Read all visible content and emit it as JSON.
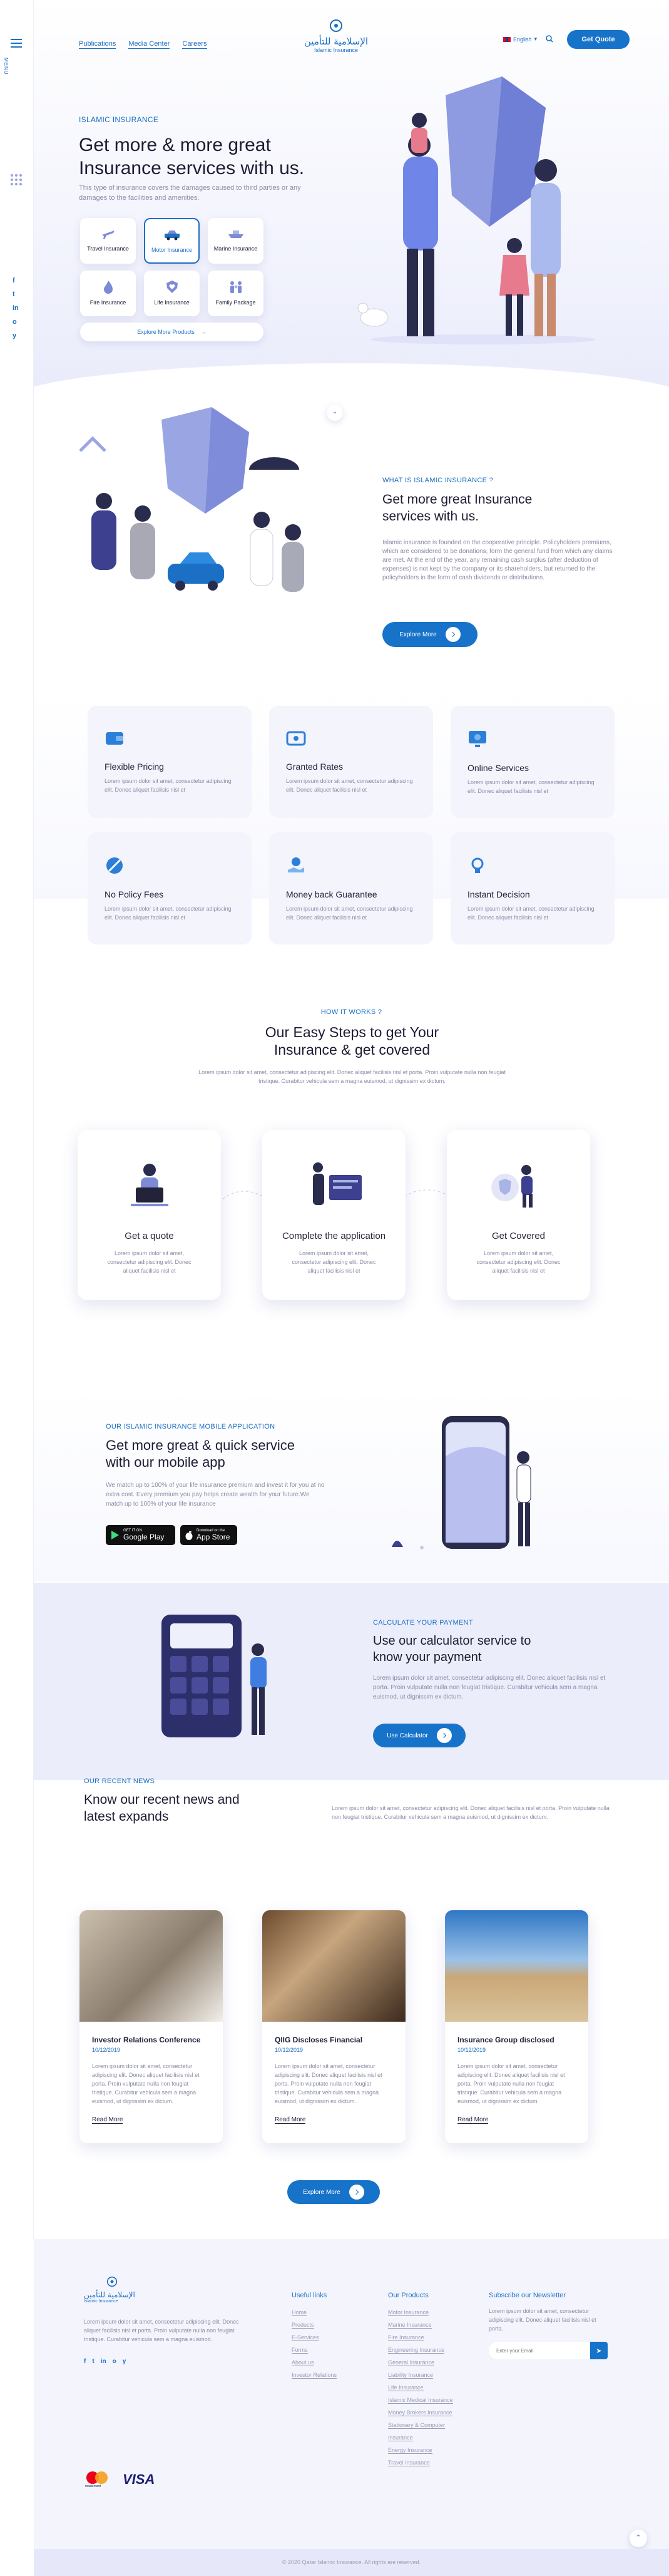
{
  "rail": {
    "menu_label": "MENU",
    "social": [
      "f",
      "t",
      "in",
      "o",
      "y"
    ]
  },
  "nav": {
    "links": [
      "Publications",
      "Media Center",
      "Careers"
    ],
    "logo_ar": "الإسلامية للتأمين",
    "logo_en": "Islamic Insurance",
    "lang": "English",
    "cta": "Get Quote"
  },
  "hero": {
    "eyebrow": "ISLAMIC INSURANCE",
    "title": "Get more & more great Insurance services with us.",
    "desc": "This type of insurance covers the damages caused to third parties or any damages to the facilities and amenities.",
    "categories": [
      "Travel Insurance",
      "Motor Insurance",
      "Marine Insurance",
      "Fire Insurance",
      "Life Insurance",
      "Family Package"
    ],
    "explore": "Explore More Products"
  },
  "about": {
    "eyebrow": "WHAT IS ISLAMIC INSURANCE ?",
    "title": "Get more great Insurance services with us.",
    "desc": "Islamic insurance is founded on the cooperative principle. Policyholders premiums, which are considered to be donations, form the general fund from which any claims are met. At the end of the year, any remaining cash surplus (after deduction of expenses) is not kept by the company or its shareholders, but returned to the policyholders in the form of cash dividends or distributions.",
    "button": "Explore More"
  },
  "features": {
    "items": [
      {
        "title": "Flexible Pricing",
        "text": "Lorem ipsum dolor sit amet, consectetur adipiscing elit. Donec aliquet facilisis nisl et"
      },
      {
        "title": "Granted Rates",
        "text": "Lorem ipsum dolor sit amet, consectetur adipiscing elit. Donec aliquet facilisis nisl et"
      },
      {
        "title": "Online Services",
        "text": "Lorem ipsum dolor sit amet, consectetur adipiscing elit. Donec aliquet facilisis nisl et"
      },
      {
        "title": "No Policy Fees",
        "text": "Lorem ipsum dolor sit amet, consectetur adipiscing elit. Donec aliquet facilisis nisl et"
      },
      {
        "title": "Money back Guarantee",
        "text": "Lorem ipsum dolor sit amet, consectetur adipiscing elit. Donec aliquet facilisis nisl et"
      },
      {
        "title": "Instant Decision",
        "text": "Lorem ipsum dolor sit amet, consectetur adipiscing elit. Donec aliquet facilisis nisl et"
      }
    ]
  },
  "how": {
    "eyebrow": "HOW IT WORKS ?",
    "title": "Our Easy Steps to get Your Insurance & get covered",
    "desc": "Lorem ipsum dolor sit amet, consectetur adipiscing elit. Donec aliquet facilisis nisl et porta. Proin vulputate nulla non feugiat tristique. Curabitur vehicula sem a magna euismod, ut dignissim ex dictum.",
    "steps": [
      {
        "title": "Get a quote",
        "text": "Lorem ipsum dolor sit amet, consectetur adipiscing elit. Donec aliquet facilisis nisl et"
      },
      {
        "title": "Complete the application",
        "text": "Lorem ipsum dolor sit amet, consectetur adipiscing elit. Donec aliquet facilisis nisl et"
      },
      {
        "title": "Get Covered",
        "text": "Lorem ipsum dolor sit amet, consectetur adipiscing elit. Donec aliquet facilisis nisl et"
      }
    ]
  },
  "app": {
    "eyebrow": "OUR ISLAMIC INSURANCE MOBILE APPLICATION",
    "title": "Get more great & quick service with our mobile app",
    "desc": "We match up to 100% of your life insurance premium and invest it for you at no extra cost. Every premium you pay helps create wealth for your future.We match up to 100% of your life insurance",
    "gp_small": "GET IT ON",
    "gp": "Google Play",
    "as_small": "Download on the",
    "as": "App Store"
  },
  "calc": {
    "eyebrow": "CALCULATE YOUR PAYMENT",
    "title": "Use our calculator service to know your payment",
    "desc": "Lorem ipsum dolor sit amet, consectetur adipiscing elit. Donec aliquet facilisis nisl et porta. Proin vulputate nulla non feugiat tristique. Curabitur vehicula sem a magna euismod, ut dignissim ex dictum.",
    "button": "Use Calculator"
  },
  "news": {
    "eyebrow": "OUR RECENT NEWS",
    "title": "Know our recent news and latest expands",
    "desc": "Lorem ipsum dolor sit amet, consectetur adipiscing elit. Donec aliquet facilisis nisl et porta. Proin vulputate nulla non feugiat tristique. Curabitur vehicula sem a magna euismod, ut dignissim ex dictum.",
    "items": [
      {
        "title": "Investor Relations Conference",
        "date": "10/12/2019",
        "text": "Lorem ipsum dolor sit amet, consectetur adipiscing elit. Donec aliquet facilisis nisl et porta. Proin vulputate nulla non feugiat tristique. Curabitur vehicula sem a magna euismod, ut dignissim ex dictum.",
        "more": "Read More"
      },
      {
        "title": "QIIG Discloses Financial",
        "date": "10/12/2019",
        "text": "Lorem ipsum dolor sit amet, consectetur adipiscing elit. Donec aliquet facilisis nisl et porta. Proin vulputate nulla non feugiat tristique. Curabitur vehicula sem a magna euismod, ut dignissim ex dictum.",
        "more": "Read More"
      },
      {
        "title": "Insurance Group disclosed",
        "date": "10/12/2019",
        "text": "Lorem ipsum dolor sit amet, consectetur adipiscing elit. Donec aliquet facilisis nisl et porta. Proin vulputate nulla non feugiat tristique. Curabitur vehicula sem a magna euismod, ut dignissim ex dictum.",
        "more": "Read More"
      }
    ],
    "button": "Explore More"
  },
  "footer": {
    "about": "Lorem ipsum dolor sit amet, consectetur adipiscing elit. Donec aliquet facilisis nisl et porta. Proin vulputate nulla non feugiat tristique. Curabitur vehicula sem a magna euismod.",
    "useful_title": "Useful links",
    "useful": [
      "Home",
      "Products",
      "E-Services",
      "Forms",
      "About us",
      "Investor Relations"
    ],
    "products_title": "Our Products",
    "products": [
      "Motor Insurance",
      "Marine Insurance",
      "Fire Insurance",
      "Engineering Insurance",
      "General Insurance",
      "Liability Insurance",
      "Life Insurance",
      "Islamic Medical Insurance",
      "Money Brokers Insurance",
      "Stationary & Computer",
      "Insurance",
      "Energy Insurance",
      "Travel Insurance"
    ],
    "newsletter_title": "Subscribe our Newsletter",
    "newsletter_text": "Lorem ipsum dolor sit amet, consectetur adipiscing elit. Donec aliquet facilisis nisl et porta.",
    "email_placeholder": "Enter your Email",
    "mastercard": "mastercard",
    "visa": "VISA",
    "copyright": "© 2020 Qatar Islamic Insurance. All rights are reserved."
  },
  "colors": {
    "primary": "#1673c9",
    "lavender": "#eef0fc",
    "ink": "#22233a"
  }
}
